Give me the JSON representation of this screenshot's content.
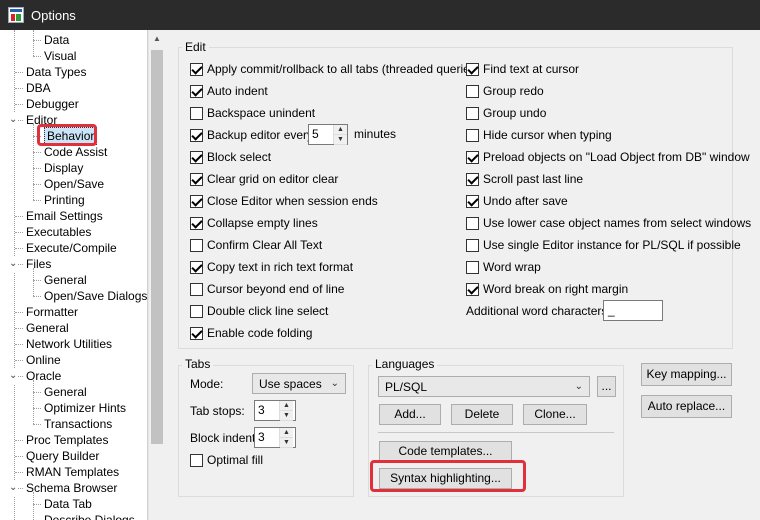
{
  "window": {
    "title": "Options"
  },
  "tree": {
    "items": [
      {
        "label": "Data",
        "level": 2
      },
      {
        "label": "Visual",
        "level": 2
      },
      {
        "label": "Data Types",
        "level": 1
      },
      {
        "label": "DBA",
        "level": 1
      },
      {
        "label": "Debugger",
        "level": 1
      },
      {
        "label": "Editor",
        "level": 1,
        "expander": "⌄"
      },
      {
        "label": "Behavior",
        "level": 2,
        "selected": true
      },
      {
        "label": "Code Assist",
        "level": 2
      },
      {
        "label": "Display",
        "level": 2
      },
      {
        "label": "Open/Save",
        "level": 2
      },
      {
        "label": "Printing",
        "level": 2
      },
      {
        "label": "Email Settings",
        "level": 1
      },
      {
        "label": "Executables",
        "level": 1
      },
      {
        "label": "Execute/Compile",
        "level": 1
      },
      {
        "label": "Files",
        "level": 1,
        "expander": "⌄"
      },
      {
        "label": "General",
        "level": 2
      },
      {
        "label": "Open/Save Dialogs",
        "level": 2
      },
      {
        "label": "Formatter",
        "level": 1
      },
      {
        "label": "General",
        "level": 1
      },
      {
        "label": "Network Utilities",
        "level": 1
      },
      {
        "label": "Online",
        "level": 1
      },
      {
        "label": "Oracle",
        "level": 1,
        "expander": "⌄"
      },
      {
        "label": "General",
        "level": 2
      },
      {
        "label": "Optimizer Hints",
        "level": 2
      },
      {
        "label": "Transactions",
        "level": 2
      },
      {
        "label": "Proc Templates",
        "level": 1
      },
      {
        "label": "Query Builder",
        "level": 1
      },
      {
        "label": "RMAN Templates",
        "level": 1
      },
      {
        "label": "Schema Browser",
        "level": 1,
        "expander": "⌄"
      },
      {
        "label": "Data Tab",
        "level": 2
      },
      {
        "label": "Describe Dialogs",
        "level": 2
      }
    ]
  },
  "edit": {
    "legend": "Edit",
    "left": [
      {
        "label": "Apply commit/rollback to all tabs (threaded queries)",
        "checked": true
      },
      {
        "label": "Auto indent",
        "checked": true
      },
      {
        "label": "Backspace unindent",
        "checked": false
      },
      {
        "label": "Backup editor every",
        "checked": true
      },
      {
        "label": "Block select",
        "checked": true
      },
      {
        "label": "Clear grid on editor clear",
        "checked": true
      },
      {
        "label": "Close Editor when session ends",
        "checked": true
      },
      {
        "label": "Collapse empty lines",
        "checked": true
      },
      {
        "label": "Confirm Clear All Text",
        "checked": false
      },
      {
        "label": "Copy text in rich text format",
        "checked": true
      },
      {
        "label": "Cursor beyond end of line",
        "checked": false
      },
      {
        "label": "Double click line select",
        "checked": false
      },
      {
        "label": "Enable code folding",
        "checked": true
      }
    ],
    "backup_value": "5",
    "backup_unit": "minutes",
    "right": [
      {
        "label": "Find text at cursor",
        "checked": true
      },
      {
        "label": "Group redo",
        "checked": false
      },
      {
        "label": "Group undo",
        "checked": false
      },
      {
        "label": "Hide cursor when typing",
        "checked": false
      },
      {
        "label": "Preload objects on \"Load Object from DB\" window",
        "checked": true
      },
      {
        "label": "Scroll past last line",
        "checked": true
      },
      {
        "label": "Undo after save",
        "checked": true
      },
      {
        "label": "Use lower case object names from select windows",
        "checked": false
      },
      {
        "label": "Use single Editor instance for PL/SQL if possible",
        "checked": false
      },
      {
        "label": "Word wrap",
        "checked": false
      },
      {
        "label": "Word break on right margin",
        "checked": true
      }
    ],
    "additional_label": "Additional word characters:",
    "additional_value": "_"
  },
  "tabs": {
    "legend": "Tabs",
    "mode_label": "Mode:",
    "mode_value": "Use spaces",
    "tab_stops_label": "Tab stops:",
    "tab_stops_value": "3",
    "block_indent_label": "Block indent:",
    "block_indent_value": "3",
    "optimal_fill_label": "Optimal fill",
    "optimal_fill_checked": false
  },
  "languages": {
    "legend": "Languages",
    "selected": "PL/SQL",
    "ellipsis": "...",
    "add": "Add...",
    "delete": "Delete",
    "clone": "Clone...",
    "code_templates": "Code templates...",
    "syntax_highlighting": "Syntax highlighting..."
  },
  "side_buttons": {
    "key_mapping": "Key mapping...",
    "auto_replace": "Auto replace..."
  },
  "colors": {
    "highlight": "#e0303a",
    "titlebar": "#2b2b2b",
    "selection": "#cce4f7"
  }
}
